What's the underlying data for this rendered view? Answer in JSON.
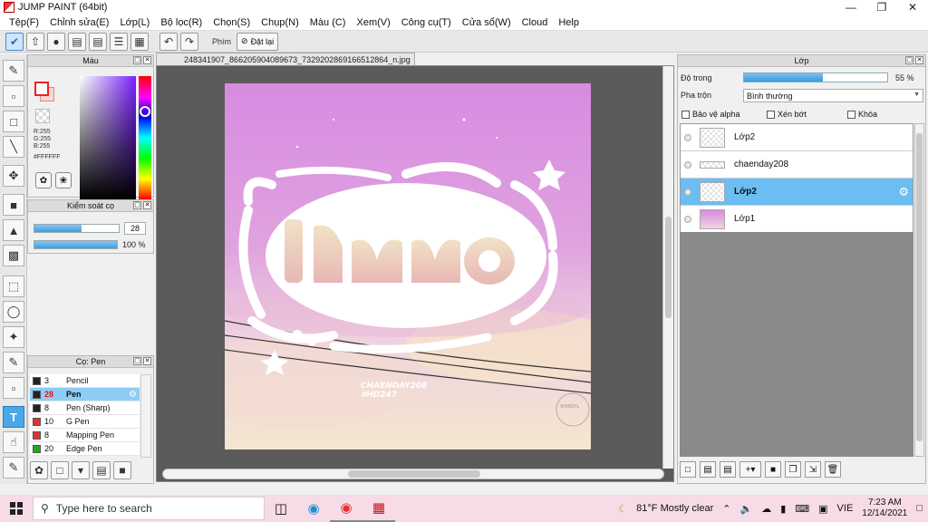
{
  "window": {
    "title": "JUMP PAINT (64bit)"
  },
  "menu": [
    "Tệp(F)",
    "Chỉnh sửa(E)",
    "Lớp(L)",
    "Bộ lọc(R)",
    "Chọn(S)",
    "Chụp(N)",
    "Màu (C)",
    "Xem(V)",
    "Công cụ(T)",
    "Cửa sổ(W)",
    "Cloud",
    "Help"
  ],
  "toolbar": {
    "shortcut_label": "Phím",
    "reset_label": "Đặt lại"
  },
  "color_panel": {
    "title": "Màu",
    "r": "R:255",
    "g": "G:255",
    "b": "B:255",
    "hex": "#FFFFFF",
    "fg_color": "#ffffff",
    "hue_color": "#7a22ff"
  },
  "brush_control": {
    "title": "Kiểm soát cọ",
    "size": "28",
    "opacity": "100 %",
    "size_fraction": 0.56,
    "opacity_fraction": 1.0
  },
  "brush_list": {
    "title": "Cọ: Pen",
    "items": [
      {
        "size": "3",
        "name": "Pencil",
        "color": "#222222"
      },
      {
        "size": "28",
        "name": "Pen",
        "color": "#222222"
      },
      {
        "size": "8",
        "name": "Pen (Sharp)",
        "color": "#222222"
      },
      {
        "size": "10",
        "name": "G Pen",
        "color": "#e03030"
      },
      {
        "size": "8",
        "name": "Mapping Pen",
        "color": "#e03030"
      },
      {
        "size": "20",
        "name": "Edge Pen",
        "color": "#22aa22"
      }
    ]
  },
  "document": {
    "filename": "248341907_866205904089673_7329202869166512864_n.jpg",
    "art_credit": "CHAENDAY208",
    "art_tag": "#HD247",
    "stamp": "SHINSYL"
  },
  "layers_panel": {
    "title": "Lớp",
    "opacity_label": "Độ trong",
    "opacity_value": "55 %",
    "opacity_fraction": 0.55,
    "blend_label": "Pha trộn",
    "blend_value": "Bình thường",
    "protect_alpha": "Bảo vệ alpha",
    "clipping": "Xén bớt",
    "lock": "Khóa",
    "layers": [
      {
        "name": "Lớp2",
        "selected": false
      },
      {
        "name": "chaenday208",
        "selected": false
      },
      {
        "name": "Lớp2",
        "selected": true
      },
      {
        "name": "Lớp1",
        "selected": false
      }
    ]
  },
  "taskbar": {
    "search_placeholder": "Type here to search",
    "weather": "81°F  Mostly clear",
    "lang": "VIE",
    "time": "7:23 AM",
    "date": "12/14/2021"
  }
}
